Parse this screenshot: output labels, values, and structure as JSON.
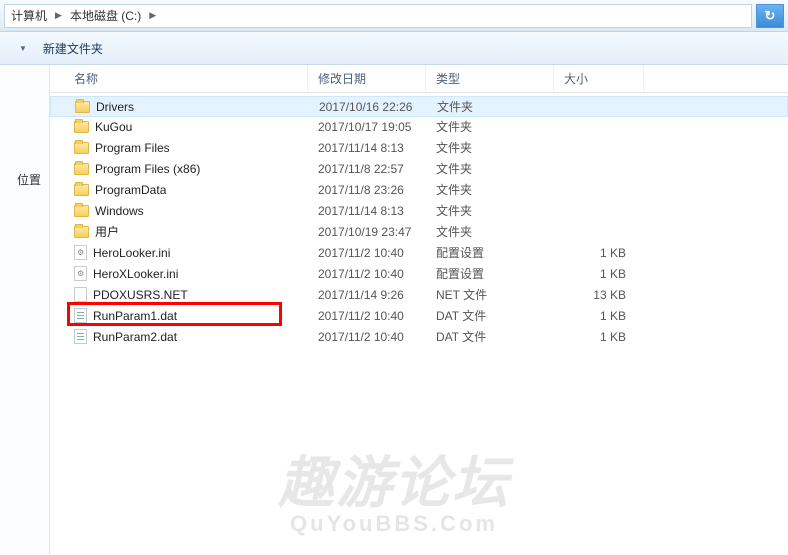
{
  "breadcrumb": {
    "items": [
      "计算机",
      "本地磁盘 (C:)"
    ]
  },
  "toolbar": {
    "dropdown_indicator": "▼",
    "new_folder": "新建文件夹"
  },
  "sidebar": {
    "item1": "位置",
    "item2": ""
  },
  "columns": {
    "name": "名称",
    "date": "修改日期",
    "type": "类型",
    "size": "大小"
  },
  "files": [
    {
      "name": "Drivers",
      "date": "2017/10/16 22:26",
      "type": "文件夹",
      "size": "",
      "icon": "folder",
      "selected": true
    },
    {
      "name": "KuGou",
      "date": "2017/10/17 19:05",
      "type": "文件夹",
      "size": "",
      "icon": "folder"
    },
    {
      "name": "Program Files",
      "date": "2017/11/14 8:13",
      "type": "文件夹",
      "size": "",
      "icon": "folder"
    },
    {
      "name": "Program Files (x86)",
      "date": "2017/11/8 22:57",
      "type": "文件夹",
      "size": "",
      "icon": "folder"
    },
    {
      "name": "ProgramData",
      "date": "2017/11/8 23:26",
      "type": "文件夹",
      "size": "",
      "icon": "folder"
    },
    {
      "name": "Windows",
      "date": "2017/11/14 8:13",
      "type": "文件夹",
      "size": "",
      "icon": "folder"
    },
    {
      "name": "用户",
      "date": "2017/10/19 23:47",
      "type": "文件夹",
      "size": "",
      "icon": "folder"
    },
    {
      "name": "HeroLooker.ini",
      "date": "2017/11/2 10:40",
      "type": "配置设置",
      "size": "1 KB",
      "icon": "ini"
    },
    {
      "name": "HeroXLooker.ini",
      "date": "2017/11/2 10:40",
      "type": "配置设置",
      "size": "1 KB",
      "icon": "ini"
    },
    {
      "name": "PDOXUSRS.NET",
      "date": "2017/11/14 9:26",
      "type": "NET 文件",
      "size": "13 KB",
      "icon": "file",
      "highlighted": true
    },
    {
      "name": "RunParam1.dat",
      "date": "2017/11/2 10:40",
      "type": "DAT 文件",
      "size": "1 KB",
      "icon": "dat"
    },
    {
      "name": "RunParam2.dat",
      "date": "2017/11/2 10:40",
      "type": "DAT 文件",
      "size": "1 KB",
      "icon": "dat"
    }
  ],
  "watermark": {
    "main": "趣游论坛",
    "sub": "QuYouBBS.Com"
  }
}
